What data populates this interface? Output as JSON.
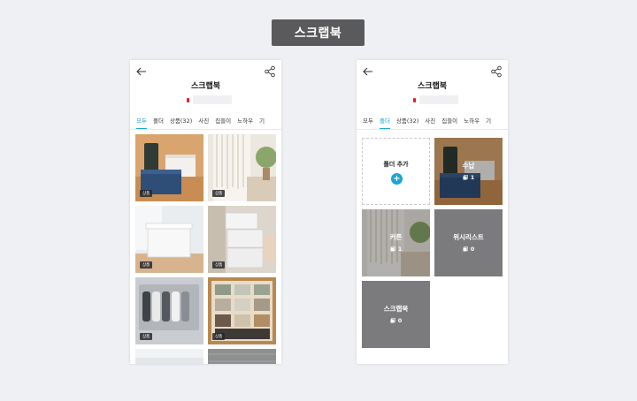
{
  "page_badge": "스크랩북",
  "left_screen": {
    "title": "스크랩북",
    "tabs": [
      "모두",
      "폴더",
      "상품(32)",
      "사진",
      "집들이",
      "노하우",
      "기"
    ],
    "active_tab": 0,
    "items": [
      {
        "tag": "상품",
        "image": "navy storage box with white basket on orange background"
      },
      {
        "tag": "상품",
        "image": "cozy room with curtains and plant"
      },
      {
        "tag": "상품",
        "image": "white storage box with lid"
      },
      {
        "tag": "상품",
        "image": "stacked white storage boxes"
      },
      {
        "tag": "상품",
        "image": "drawer organizer with rolled clothes"
      },
      {
        "tag": "상품",
        "image": "wooden shelf with storage baskets"
      }
    ]
  },
  "right_screen": {
    "title": "스크랩북",
    "tabs": [
      "모두",
      "폴더",
      "상품(32)",
      "사진",
      "집들이",
      "노하우",
      "기"
    ],
    "active_tab": 1,
    "add_folder_label": "폴더 추가",
    "folders": [
      {
        "name": "수납",
        "count": "1"
      },
      {
        "name": "커튼",
        "count": "1"
      },
      {
        "name": "위시리스트",
        "count": "0"
      },
      {
        "name": "스크랩북",
        "count": "0"
      }
    ]
  },
  "colors": {
    "accent": "#1aa6d6",
    "badge": "#5a5a5c",
    "folder_gray": "#7b7b7d"
  }
}
